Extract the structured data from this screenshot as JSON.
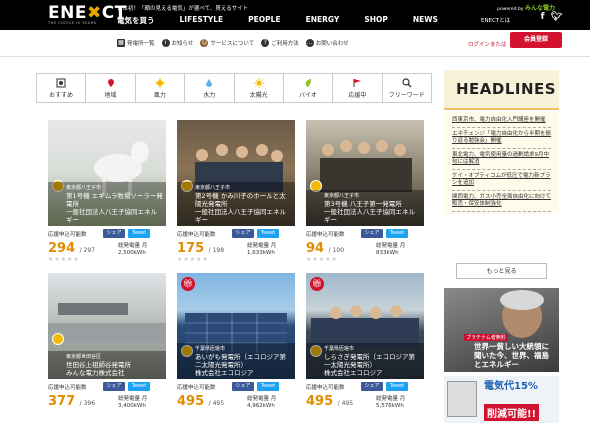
{
  "header": {
    "logo": "ENE",
    "logo_x": "✖",
    "logo_tail": "CT",
    "logo_sub": "THE CHOICE IS YOURS",
    "tagline": "日本初！「顔の見える電気」が選べて、買えるサイト",
    "nav": [
      "電気を買う",
      "LIFESTYLE",
      "PEOPLE",
      "ENERGY",
      "SHOP",
      "NEWS"
    ],
    "powered_by": "powered by",
    "powered_brand": "みんな電力",
    "about": "ENECTとは"
  },
  "subnav": {
    "links": [
      {
        "icon": "grid-icon",
        "label": "発電所一覧"
      },
      {
        "icon": "info-icon",
        "label": "お知らせ"
      },
      {
        "icon": "service-icon",
        "label": "サービスについて"
      },
      {
        "icon": "help-icon",
        "label": "ご利用方法"
      },
      {
        "icon": "chat-icon",
        "label": "お問い合わせ"
      }
    ],
    "login": "ログインまたは",
    "register": "会員登録"
  },
  "categories": [
    {
      "icon": "recommend-icon",
      "label": "おすすめ",
      "color": "#333333"
    },
    {
      "icon": "region-icon",
      "label": "地域",
      "color": "#d3122f"
    },
    {
      "icon": "wind-icon",
      "label": "風力",
      "color": "#f5b800"
    },
    {
      "icon": "water-icon",
      "label": "水力",
      "color": "#5ab4e5"
    },
    {
      "icon": "solar-icon",
      "label": "太陽光",
      "color": "#f5b800"
    },
    {
      "icon": "bio-icon",
      "label": "バイオ",
      "color": "#8fc31f"
    },
    {
      "icon": "support-icon",
      "label": "応援中",
      "color": "#d3122f"
    },
    {
      "icon": "freeword-icon",
      "label": "フリーワード",
      "color": "#333333"
    }
  ],
  "cards": [
    {
      "loc": "東京都八王子市",
      "title": "第1号機 エギムラ牧場ソーラー発電所",
      "org": "一般社団法人八王子協同エネルギー",
      "share_label": "応援申込可能数",
      "fb": "シェア",
      "tw": "Tweet",
      "count": "294",
      "total": "/ 297",
      "cap_label": "総発電量 月",
      "cap": "2,500kWh",
      "gift": false
    },
    {
      "loc": "東京都八王子市",
      "title": "第2号機 かみ川子のホールと太陽光発電所",
      "org": "一般社団法人八王子協同エネルギー",
      "share_label": "応援申込可能数",
      "fb": "シェア",
      "tw": "Tweet",
      "count": "175",
      "total": "/ 198",
      "cap_label": "総発電量 月",
      "cap": "1,633kWh",
      "gift": false
    },
    {
      "loc": "東京都八王子市",
      "title": "第3号機 八王子第一発電所",
      "org": "一般社団法人八王子協同エネルギー",
      "share_label": "応援申込可能数",
      "fb": "シェア",
      "tw": "Tweet",
      "count": "94",
      "total": "/ 100",
      "cap_label": "総発電量 月",
      "cap": "833kWh",
      "gift": false
    },
    {
      "loc": "東京都世田谷区",
      "title": "世田谷上祖師谷発電所",
      "org": "みんな電力株式会社",
      "share_label": "応援申込可能数",
      "fb": "シェア",
      "tw": "Tweet",
      "count": "377",
      "total": "/ 396",
      "cap_label": "総発電量 月",
      "cap": "3,400kWh",
      "gift": false
    },
    {
      "loc": "千葉県匝瑳市",
      "title": "あいがも発電所（エコロジア第二太陽光発電所）",
      "org": "株式会社エコロジア",
      "share_label": "応援申込可能数",
      "fb": "シェア",
      "tw": "Tweet",
      "count": "495",
      "total": "/ 495",
      "cap_label": "総発電量 月",
      "cap": "4,962kWh",
      "gift": true
    },
    {
      "loc": "千葉県匝瑳市",
      "title": "しらさぎ発電所（エコロジア第一太陽光発電所）",
      "org": "株式会社エコロジア",
      "share_label": "応援申込可能数",
      "fb": "シェア",
      "tw": "Tweet",
      "count": "495",
      "total": "/ 495",
      "cap_label": "総発電量 月",
      "cap": "5,576kWh",
      "gift": true
    }
  ],
  "sidebar": {
    "headline": "HEADLINES",
    "news": [
      "西東京市、電力自由化入門講座を開催",
      "エネチェンジ「電力自由化から半期を振り返る勉強会」開催",
      "東北電力、電気使用量の過剰請求9月中旬には解消",
      "ケイ・オプティコムが低圧で電力新プランを追加",
      "関西電力、ガス小売全面自由化に向けて販売・保安体制強化"
    ],
    "more": "もっと見る",
    "ad1_badge": "プラチナム者無料",
    "ad1_text": "世界一貧しい大統領に聞いた今、世界、福島とエネルギー",
    "ad2_line1": "電気代15%",
    "ad2_line2": "削減可能!!"
  }
}
